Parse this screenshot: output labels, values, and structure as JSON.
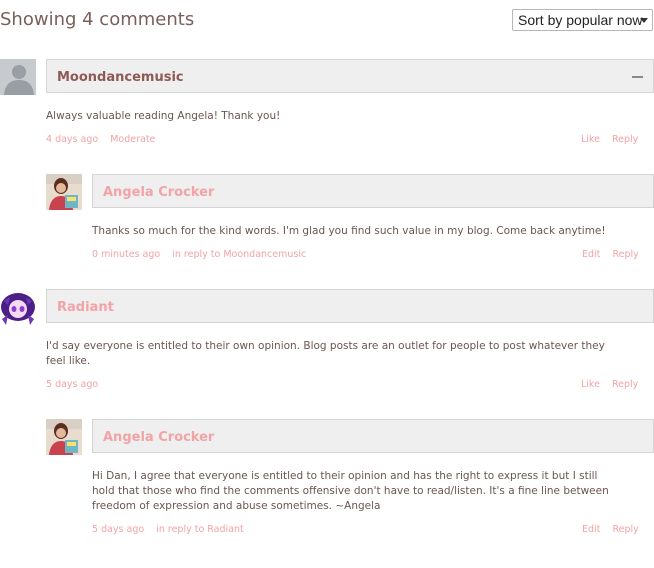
{
  "header": {
    "count_text": "Showing 4 comments",
    "sort_label": "Sort by popular now"
  },
  "colors": {
    "accent": "#f2a3a6",
    "author": "#8e5a56",
    "text": "#6a5651",
    "bar": "#efefef"
  },
  "comments": [
    {
      "author": "Moondancemusic",
      "avatar": "default-user-silhouette",
      "text": "Always valuable reading Angela! Thank you!",
      "time": "4 days ago",
      "extra": "Moderate",
      "actions": [
        "Like",
        "Reply"
      ]
    },
    {
      "author": "Angela Crocker",
      "avatar": "angela-photo",
      "text": "Thanks so much for the kind words. I'm glad you find such value in my blog. Come back anytime!",
      "time": "0 minutes ago",
      "extra": "in reply to Moondancemusic",
      "actions": [
        "Edit",
        "Reply"
      ]
    },
    {
      "author": "Radiant",
      "avatar": "radiant-avatar",
      "text_lines": [
        "I'd say everyone is entitled to their own opinion. Blog posts are an outlet for people to post whatever they",
        "feel like."
      ],
      "time": "5 days ago",
      "actions": [
        "Like",
        "Reply"
      ]
    },
    {
      "author": "Angela Crocker",
      "avatar": "angela-photo",
      "text_lines": [
        "Hi Dan, I agree that everyone is entitled to their opinion and has the right to express it but I still",
        "hold that those who find the comments offensive don't have to read/listen. It's a fine line between",
        "freedom of expression and abuse sometimes. ~Angela"
      ],
      "time": "5 days ago",
      "extra": "in reply to Radiant",
      "actions": [
        "Edit",
        "Reply"
      ]
    }
  ]
}
